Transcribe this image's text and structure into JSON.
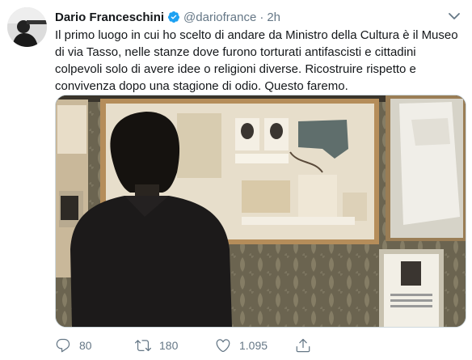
{
  "author": {
    "name": "Dario Franceschini",
    "handle": "@dariofrance",
    "separator": "·",
    "time": "2h"
  },
  "tweet": {
    "text": "Il primo luogo in cui ho scelto di andare da Ministro della Cultura è il Museo di via Tasso, nelle stanze dove furono torturati antifascisti e cittadini colpevoli solo di avere idee o religioni diverse.  Ricostruire rispetto e convivenza dopo una stagione di odio. Questo faremo."
  },
  "media": {
    "caption_label": "SIGNORE FRANCO BORGHI"
  },
  "actions": {
    "reply_count": "80",
    "retweet_count": "180",
    "like_count": "1.095"
  },
  "colors": {
    "verified": "#1da1f2",
    "icon_gray": "#657786",
    "text": "#14171a"
  },
  "icons": [
    "verified-icon",
    "more-icon",
    "reply-icon",
    "retweet-icon",
    "like-icon",
    "share-icon"
  ]
}
